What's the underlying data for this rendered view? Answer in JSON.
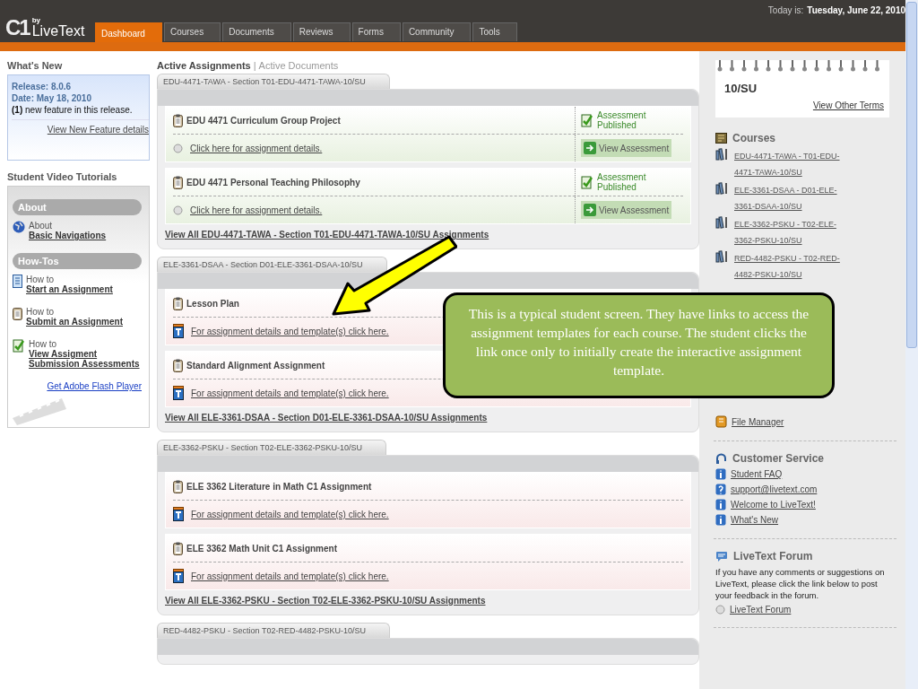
{
  "header": {
    "logo_mark": "C1",
    "logo_by": "by",
    "logo_name": "LiveText",
    "today_label": "Today is:",
    "today_date": "Tuesday, June 22, 2010",
    "tabs": [
      {
        "label": "Dashboard",
        "selected": true
      },
      {
        "label": "Courses",
        "selected": false
      },
      {
        "label": "Documents",
        "selected": false
      },
      {
        "label": "Reviews",
        "selected": false
      },
      {
        "label": "Forms",
        "selected": false
      },
      {
        "label": "Community",
        "selected": false
      },
      {
        "label": "Tools",
        "selected": false
      }
    ]
  },
  "whats_new": {
    "title": "What's New",
    "release": "Release: 8.0.6",
    "date": "Date: May 18, 2010",
    "note": "**(1)** new feature in this release.",
    "link": "View New Feature details"
  },
  "tutorials": {
    "title": "Student Video Tutorials",
    "groups": [
      {
        "heading": "About",
        "items": [
          {
            "kind": "globe",
            "prefix": "About",
            "link": "Basic Navigations"
          }
        ]
      },
      {
        "heading": "How-Tos",
        "items": [
          {
            "kind": "doc",
            "prefix": "How to",
            "link": "Start an Assignment"
          },
          {
            "kind": "clipboard",
            "prefix": "How to",
            "link": "Submit an Assignment"
          },
          {
            "kind": "check",
            "prefix": "How to",
            "link": "View Assigment Submission Assessments"
          }
        ]
      }
    ],
    "flash_link": "Get Adobe Flash Player"
  },
  "main": {
    "tabs": [
      {
        "label": "Active Assignments",
        "selected": true
      },
      {
        "label": "Active Documents",
        "selected": false
      }
    ],
    "separator": "|",
    "sections": [
      {
        "title": "EDU-4471-TAWA - Section T01-EDU-4471-TAWA-10/SU",
        "items": [
          {
            "kind": "published",
            "name": "EDU 4471 Curriculum Group Project",
            "link": "Click here for assignment details.",
            "status": "Assessment Published",
            "action": "View Assessment"
          },
          {
            "kind": "published",
            "name": "EDU 4471 Personal Teaching Philosophy",
            "link": "Click here for assignment details.",
            "status": "Assessment Published",
            "action": "View Assessment"
          }
        ],
        "view_all": "View All EDU-4471-TAWA - Section T01-EDU-4471-TAWA-10/SU Assignments"
      },
      {
        "title": "ELE-3361-DSAA - Section D01-ELE-3361-DSAA-10/SU",
        "items": [
          {
            "kind": "template",
            "name": "Lesson Plan",
            "link": "For assignment details and template(s) click here."
          },
          {
            "kind": "template",
            "name": "Standard Alignment Assignment",
            "link": "For assignment details and template(s) click here."
          }
        ],
        "view_all": "View All ELE-3361-DSAA - Section D01-ELE-3361-DSAA-10/SU Assignments"
      },
      {
        "title": "ELE-3362-PSKU - Section T02-ELE-3362-PSKU-10/SU",
        "items": [
          {
            "kind": "template",
            "name": "ELE 3362 Literature in Math C1 Assignment",
            "link": "For assignment details and template(s) click here."
          },
          {
            "kind": "template",
            "name": "ELE 3362 Math Unit C1 Assignment",
            "link": "For assignment details and template(s) click here."
          }
        ],
        "view_all": "View All ELE-3362-PSKU - Section T02-ELE-3362-PSKU-10/SU Assignments"
      },
      {
        "title": "RED-4482-PSKU - Section T02-RED-4482-PSKU-10/SU"
      }
    ]
  },
  "sidebar": {
    "term": "10/SU",
    "other_terms": "View Other Terms",
    "courses_title": "Courses",
    "courses": [
      "EDU-4471-TAWA - T01-EDU-4471-TAWA-10/SU",
      "ELE-3361-DSAA - D01-ELE-3361-DSAA-10/SU",
      "ELE-3362-PSKU - T02-ELE-3362-PSKU-10/SU",
      "RED-4482-PSKU - T02-RED-4482-PSKU-10/SU"
    ],
    "file_manager": "File Manager",
    "service_title": "Customer Service",
    "service_links": [
      {
        "kind": "info",
        "label": "Student FAQ"
      },
      {
        "kind": "question",
        "label": "support@livetext.com"
      },
      {
        "kind": "info",
        "label": "Welcome to LiveText!"
      },
      {
        "kind": "info",
        "label": "What's New"
      }
    ],
    "forum_title": "LiveText Forum",
    "forum_text": "If you have any comments or suggestions on LiveText, please click the link below to post your feedback in the forum.",
    "forum_link": "LiveText Forum"
  },
  "callout": {
    "text": "This is a typical student screen.  They have links to access the assignment templates for each course.  The student clicks the link once only to initially create the interactive assignment template."
  }
}
